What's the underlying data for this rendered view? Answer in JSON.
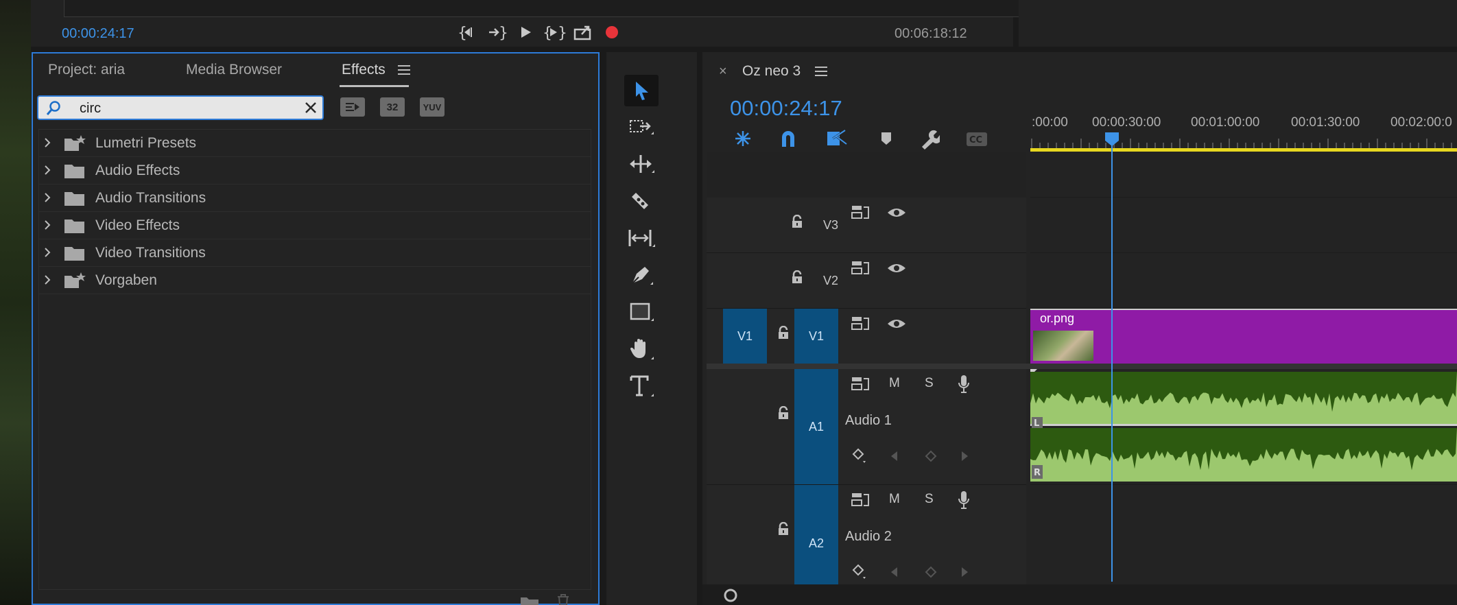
{
  "program_monitor": {
    "current_timecode": "00:00:24:17",
    "duration_timecode": "00:06:18:12"
  },
  "effects_panel": {
    "tabs": [
      "Project: aria",
      "Media Browser",
      "Effects"
    ],
    "search_value": "circ",
    "filter_labels": [
      "32",
      "YUV"
    ],
    "tree_items": [
      "Lumetri Presets",
      "Audio Effects",
      "Audio Transitions",
      "Video Effects",
      "Video Transitions",
      "Vorgaben"
    ]
  },
  "timeline": {
    "sequence_name": "Oz neo 3",
    "timecode": "00:00:24:17",
    "ruler_labels": [
      ":00:00",
      "00:00:30:00",
      "00:01:00:00",
      "00:01:30:00",
      "00:02:00:0"
    ],
    "tracks": {
      "v3": "V3",
      "v2": "V2",
      "v1_source": "V1",
      "v1": "V1",
      "a1": "A1",
      "a1_name": "Audio 1",
      "a2": "A2",
      "a2_name": "Audio 2",
      "mute": "M",
      "solo": "S",
      "channel_l": "L",
      "channel_r": "R"
    },
    "clip_name": "or.png"
  },
  "colors": {
    "accent": "#3d93e8",
    "clip_purple": "#8f1ba6",
    "audio_dark": "#2d5a10",
    "audio_light": "#9cc86e",
    "record": "#e8343a",
    "work_area": "#e7d720"
  }
}
